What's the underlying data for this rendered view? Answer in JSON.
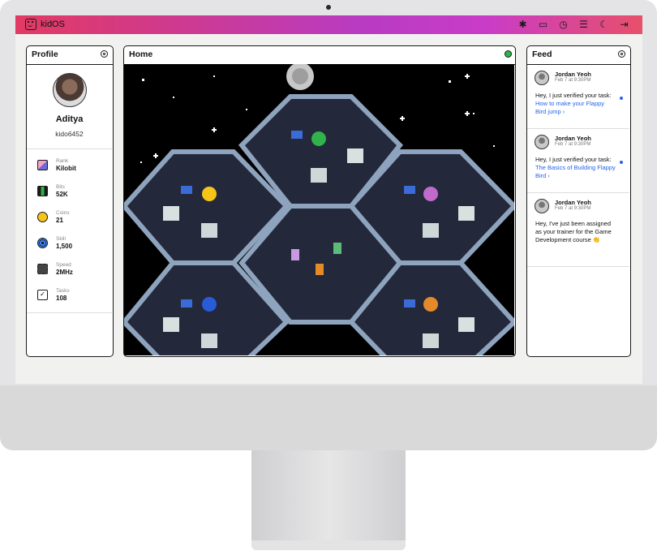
{
  "app": {
    "brand": "kidOS"
  },
  "topbar": {
    "icons": [
      "bug-icon",
      "video-icon",
      "clock-icon",
      "sliders-icon",
      "moon-icon",
      "logout-icon"
    ]
  },
  "profile": {
    "title": "Profile",
    "name": "Aditya",
    "username": "kido6452",
    "stats": [
      {
        "label": "Rank",
        "value": "Kilobit",
        "icon": "rank-icon"
      },
      {
        "label": "Bits",
        "value": "52K",
        "icon": "bits-icon"
      },
      {
        "label": "Coins",
        "value": "21",
        "icon": "coin-icon"
      },
      {
        "label": "Skill",
        "value": "1,500",
        "icon": "skill-icon"
      },
      {
        "label": "Speed",
        "value": "2MHz",
        "icon": "chip-icon"
      },
      {
        "label": "Tasks",
        "value": "108",
        "icon": "tasks-icon"
      }
    ]
  },
  "home": {
    "title": "Home"
  },
  "feed": {
    "title": "Feed",
    "posts": [
      {
        "author": "Jordan Yeoh",
        "time": "Feb 7 at 9:30PM",
        "text": "Hey, I just verified your task: ",
        "link": "How to make your Flappy Bird jump ›",
        "unread": true
      },
      {
        "author": "Jordan Yeoh",
        "time": "Feb 7 at 9:30PM",
        "text": "Hey, I just verified your task: ",
        "link": "The Basics of Building Flappy Bird ›",
        "unread": true
      },
      {
        "author": "Jordan Yeoh",
        "time": "Feb 7 at 9:30PM",
        "text": "Hey, I've just been assigned as your trainer for the Game Development course 👏",
        "link": "",
        "unread": false
      }
    ]
  },
  "colors": {
    "accent": "#2563eb",
    "online": "#2fb34a",
    "gradient_start": "#e23a63",
    "gradient_mid": "#b83bc2",
    "gradient_end": "#e7506a"
  }
}
